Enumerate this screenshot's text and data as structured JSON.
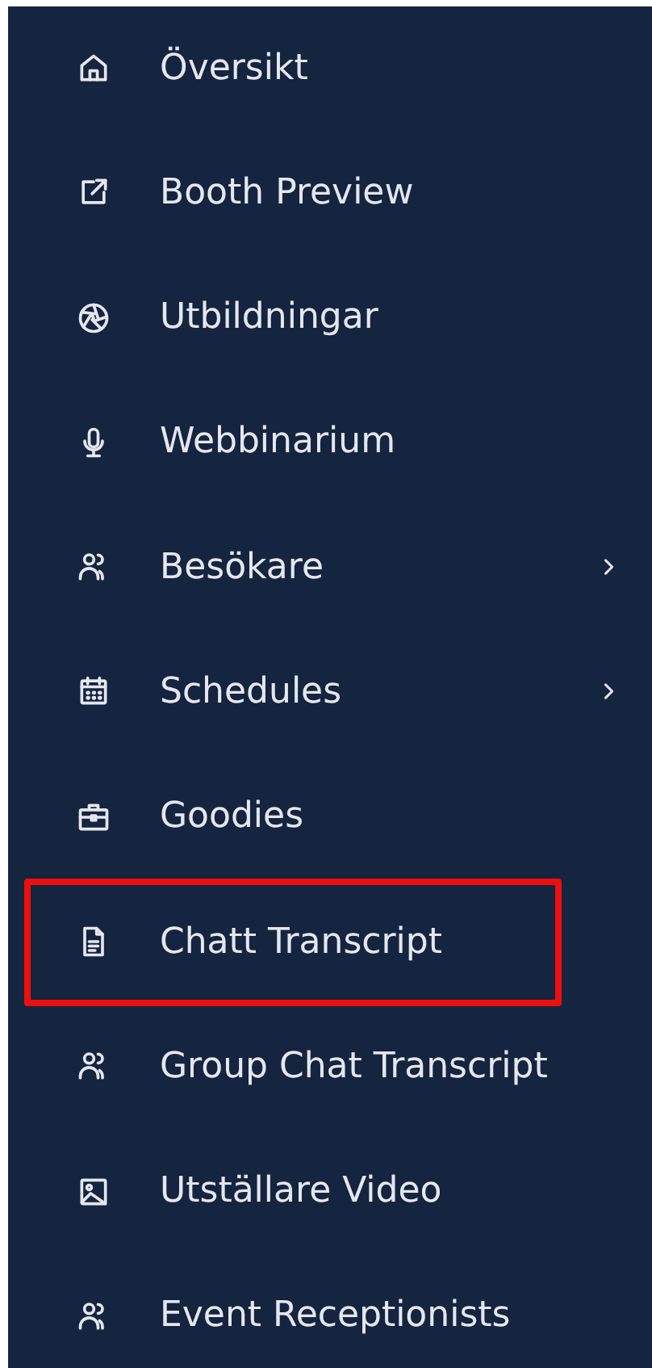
{
  "sidebar": {
    "items": [
      {
        "label": "Översikt",
        "kind": "home",
        "expandable": false,
        "highlighted": false
      },
      {
        "label": "Booth Preview",
        "kind": "external",
        "expandable": false,
        "highlighted": false
      },
      {
        "label": "Utbildningar",
        "kind": "aperture",
        "expandable": false,
        "highlighted": false
      },
      {
        "label": "Webbinarium",
        "kind": "mic",
        "expandable": false,
        "highlighted": false
      },
      {
        "label": "Besökare",
        "kind": "users",
        "expandable": true,
        "highlighted": false
      },
      {
        "label": "Schedules",
        "kind": "calendar",
        "expandable": true,
        "highlighted": false
      },
      {
        "label": "Goodies",
        "kind": "briefcase",
        "expandable": false,
        "highlighted": false
      },
      {
        "label": "Chatt Transcript",
        "kind": "file",
        "expandable": false,
        "highlighted": true
      },
      {
        "label": "Group Chat Transcript",
        "kind": "users",
        "expandable": false,
        "highlighted": false
      },
      {
        "label": "Utställare Video",
        "kind": "image",
        "expandable": false,
        "highlighted": false
      },
      {
        "label": "Event Receptionists",
        "kind": "users",
        "expandable": false,
        "highlighted": false
      }
    ]
  }
}
